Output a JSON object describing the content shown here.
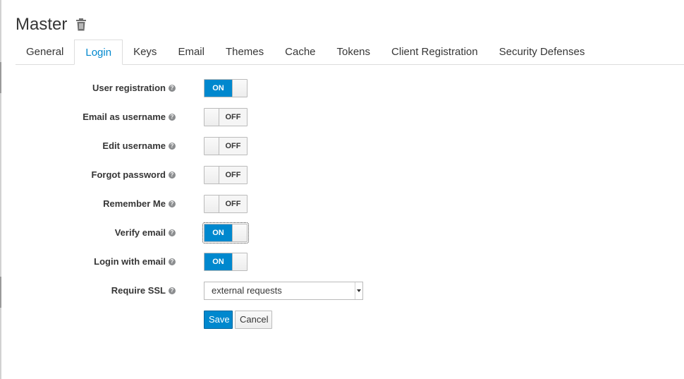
{
  "realm": {
    "title": "Master",
    "delete_icon": "trash-icon"
  },
  "tabs": [
    {
      "label": "General",
      "active": false
    },
    {
      "label": "Login",
      "active": true
    },
    {
      "label": "Keys",
      "active": false
    },
    {
      "label": "Email",
      "active": false
    },
    {
      "label": "Themes",
      "active": false
    },
    {
      "label": "Cache",
      "active": false
    },
    {
      "label": "Tokens",
      "active": false
    },
    {
      "label": "Client Registration",
      "active": false
    },
    {
      "label": "Security Defenses",
      "active": false
    }
  ],
  "settings": [
    {
      "label": "User registration",
      "state": "ON",
      "help_icon": "question-circle-icon"
    },
    {
      "label": "Email as username",
      "state": "OFF",
      "help_icon": "question-circle-icon"
    },
    {
      "label": "Edit username",
      "state": "OFF",
      "help_icon": "question-circle-icon"
    },
    {
      "label": "Forgot password",
      "state": "OFF",
      "help_icon": "question-circle-icon"
    },
    {
      "label": "Remember Me",
      "state": "OFF",
      "help_icon": "question-circle-icon"
    },
    {
      "label": "Verify email",
      "state": "ON",
      "focused": true,
      "help_icon": "question-circle-icon"
    },
    {
      "label": "Login with email",
      "state": "ON",
      "help_icon": "question-circle-icon"
    }
  ],
  "require_ssl": {
    "label": "Require SSL",
    "value": "external requests",
    "help_icon": "question-circle-icon"
  },
  "actions": {
    "save_label": "Save",
    "cancel_label": "Cancel"
  },
  "colors": {
    "accent": "#0088ce",
    "text": "#363636",
    "border": "#bbbbbb"
  }
}
